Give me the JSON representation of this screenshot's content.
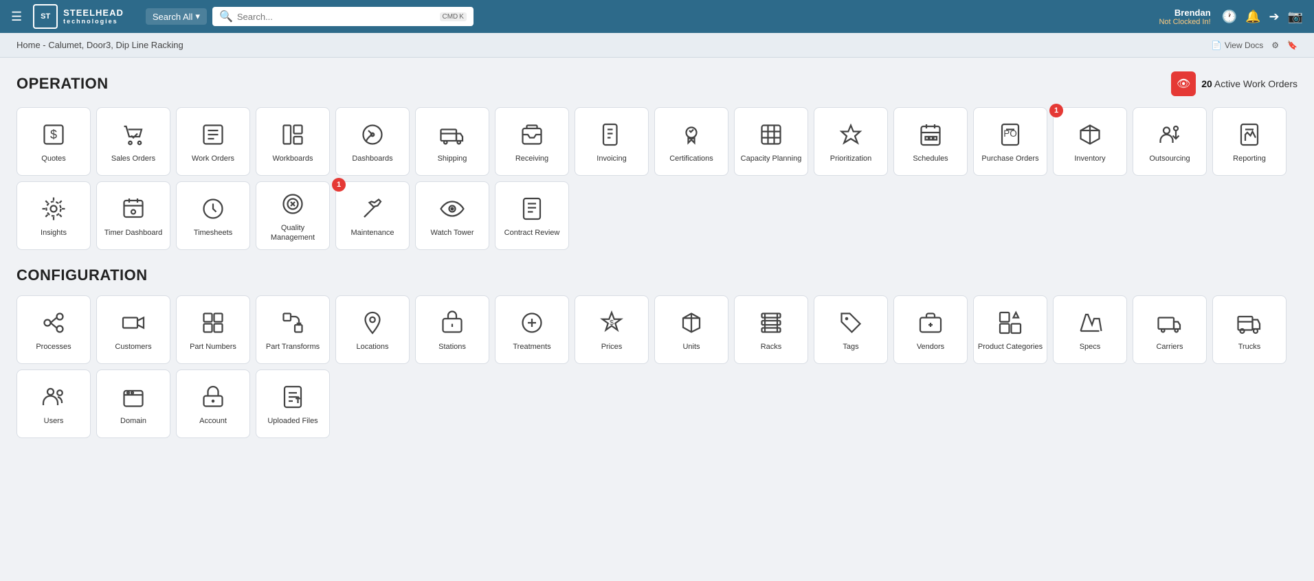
{
  "header": {
    "menu_label": "☰",
    "logo_initials": "ST",
    "brand_name": "STEELHEAD",
    "brand_sub": "technologies",
    "search_all_label": "Search All",
    "search_placeholder": "Search...",
    "shortcut_cmd": "CMD",
    "shortcut_key": "K",
    "user_name": "Brendan",
    "user_status": "Not Clocked In!",
    "icons": [
      "clock",
      "bell",
      "logout",
      "camera"
    ]
  },
  "breadcrumb": {
    "text": "Home - Calumet, Door3, Dip Line Racking",
    "view_docs": "View Docs"
  },
  "operation": {
    "title": "OPERATION",
    "active_orders_count": "20",
    "active_orders_label": "Active Work Orders",
    "tiles": [
      {
        "id": "quotes",
        "label": "Quotes",
        "icon": "dollar"
      },
      {
        "id": "sales-orders",
        "label": "Sales Orders",
        "icon": "cart-check"
      },
      {
        "id": "work-orders",
        "label": "Work Orders",
        "icon": "list-check"
      },
      {
        "id": "workboards",
        "label": "Workboards",
        "icon": "board"
      },
      {
        "id": "dashboards",
        "label": "Dashboards",
        "icon": "dashboard"
      },
      {
        "id": "shipping",
        "label": "Shipping",
        "icon": "truck"
      },
      {
        "id": "receiving",
        "label": "Receiving",
        "icon": "inbox"
      },
      {
        "id": "invoicing",
        "label": "Invoicing",
        "icon": "invoice"
      },
      {
        "id": "certifications",
        "label": "Certifications",
        "icon": "cert"
      },
      {
        "id": "capacity-planning",
        "label": "Capacity Planning",
        "icon": "capacity"
      },
      {
        "id": "prioritization",
        "label": "Prioritization",
        "icon": "priority"
      },
      {
        "id": "schedules",
        "label": "Schedules",
        "icon": "calendar"
      },
      {
        "id": "purchase-orders",
        "label": "Purchase Orders",
        "icon": "po"
      },
      {
        "id": "inventory",
        "label": "Inventory",
        "icon": "box",
        "badge": 1
      },
      {
        "id": "outsourcing",
        "label": "Outsourcing",
        "icon": "outsource"
      },
      {
        "id": "reporting",
        "label": "Reporting",
        "icon": "report"
      },
      {
        "id": "insights",
        "label": "Insights",
        "icon": "insights"
      },
      {
        "id": "timer-dashboard",
        "label": "Timer Dashboard",
        "icon": "timer"
      },
      {
        "id": "timesheets",
        "label": "Timesheets",
        "icon": "timesheet"
      },
      {
        "id": "quality-management",
        "label": "Quality Management",
        "icon": "quality"
      },
      {
        "id": "maintenance",
        "label": "Maintenance",
        "icon": "maintenance",
        "badge": 1
      },
      {
        "id": "watch-tower",
        "label": "Watch Tower",
        "icon": "watchtower"
      },
      {
        "id": "contract-review",
        "label": "Contract Review",
        "icon": "contract"
      }
    ]
  },
  "configuration": {
    "title": "CONFIGURATION",
    "tiles": [
      {
        "id": "processes",
        "label": "Processes",
        "icon": "processes"
      },
      {
        "id": "customers",
        "label": "Customers",
        "icon": "customers"
      },
      {
        "id": "part-numbers",
        "label": "Part Numbers",
        "icon": "part-numbers"
      },
      {
        "id": "part-transforms",
        "label": "Part Transforms",
        "icon": "part-transforms"
      },
      {
        "id": "locations",
        "label": "Locations",
        "icon": "locations"
      },
      {
        "id": "stations",
        "label": "Stations",
        "icon": "stations"
      },
      {
        "id": "treatments",
        "label": "Treatments",
        "icon": "treatments"
      },
      {
        "id": "prices",
        "label": "Prices",
        "icon": "prices"
      },
      {
        "id": "units",
        "label": "Units",
        "icon": "units"
      },
      {
        "id": "racks",
        "label": "Racks",
        "icon": "racks"
      },
      {
        "id": "tags",
        "label": "Tags",
        "icon": "tags"
      },
      {
        "id": "vendors",
        "label": "Vendors",
        "icon": "vendors"
      },
      {
        "id": "product-categories",
        "label": "Product Categories",
        "icon": "product-categories"
      },
      {
        "id": "specs",
        "label": "Specs",
        "icon": "specs"
      },
      {
        "id": "carriers",
        "label": "Carriers",
        "icon": "carriers"
      },
      {
        "id": "trucks",
        "label": "Trucks",
        "icon": "trucks"
      },
      {
        "id": "users",
        "label": "Users",
        "icon": "users"
      },
      {
        "id": "domain",
        "label": "Domain",
        "icon": "domain"
      },
      {
        "id": "account",
        "label": "Account",
        "icon": "account"
      },
      {
        "id": "uploaded-files",
        "label": "Uploaded Files",
        "icon": "uploaded-files"
      }
    ]
  }
}
